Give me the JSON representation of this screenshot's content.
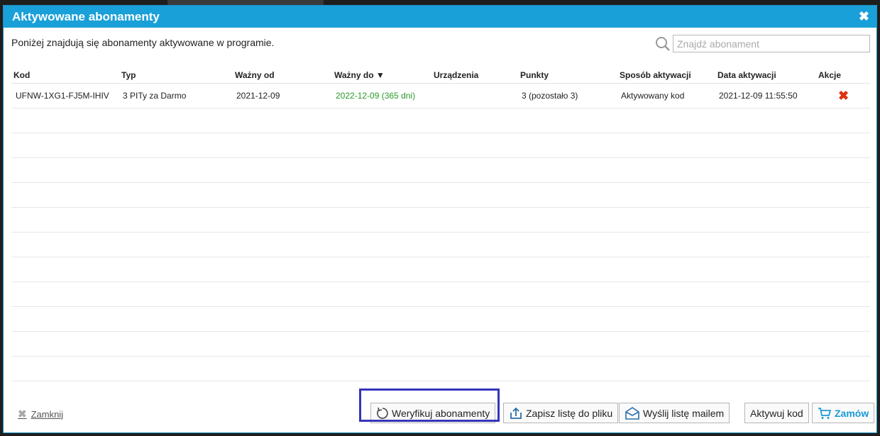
{
  "dialog": {
    "title": "Aktywowane abonamenty",
    "intro": "Poniżej znajdują się abonamenty aktywowane w programie.",
    "search_placeholder": "Znajdź abonament"
  },
  "table": {
    "headers": {
      "code": "Kod",
      "type": "Typ",
      "valid_from": "Ważny od",
      "valid_to": "Ważny do ▼",
      "devices": "Urządzenia",
      "points": "Punkty",
      "activation_method": "Sposób aktywacji",
      "activation_date": "Data aktywacji",
      "actions": "Akcje"
    },
    "rows": [
      {
        "code": "UFNW-1XG1-FJ5M-IHIV",
        "type": "3 PITy za Darmo",
        "valid_from": "2021-12-09",
        "valid_to": "2022-12-09 (365 dni)",
        "devices": "",
        "points": "3 (pozostało 3)",
        "activation_method": "Aktywowany kod",
        "activation_date": "2021-12-09 11:55:50"
      }
    ]
  },
  "footer": {
    "close_label": "Zamknij",
    "verify_label": "Weryfikuj abonamenty",
    "save_label": "Zapisz listę do pliku",
    "mail_label": "Wyślij listę mailem",
    "activate_label": "Aktywuj kod",
    "order_label": "Zamów"
  },
  "colors": {
    "title_bar": "#1aa0d8",
    "valid_green": "#2a9a2a",
    "delete_red": "#e03010",
    "highlight": "#3535bb"
  }
}
